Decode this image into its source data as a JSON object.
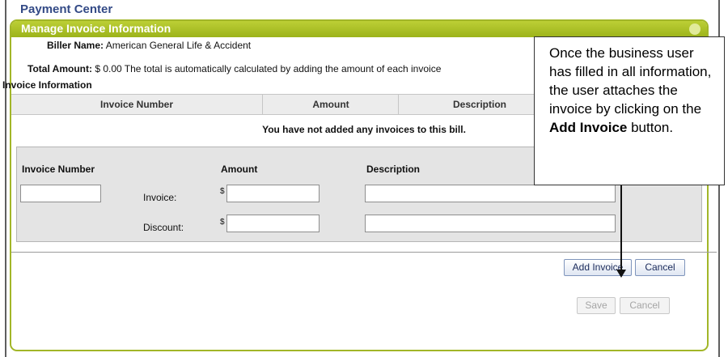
{
  "page": {
    "title": "Payment Center"
  },
  "panel": {
    "title": "Manage Invoice Information"
  },
  "biller": {
    "label": "Biller Name:",
    "value": " American General Life & Accident"
  },
  "total": {
    "label": "Total Amount:",
    "value": " $ 0.00 The total is automatically calculated by adding the amount of each invoice"
  },
  "invoice_section_label": "Invoice Information",
  "table": {
    "columns": [
      "Invoice Number",
      "Amount",
      "Description"
    ],
    "empty_message": "You have not added any invoices to this bill."
  },
  "entry": {
    "invoice_number_label": "Invoice Number",
    "amount_label": "Amount",
    "description_label": "Description",
    "invoice_row_label": "Invoice:",
    "discount_row_label": "Discount:",
    "currency_symbol": "$",
    "invoice_number_value": "",
    "invoice_amount_value": "",
    "invoice_description_value": "",
    "discount_amount_value": "",
    "discount_description_value": ""
  },
  "buttons": {
    "add_invoice": "Add Invoice",
    "cancel": "Cancel",
    "save": "Save",
    "cancel_bottom": "Cancel"
  },
  "callout": {
    "text_1": "Once the business user has filled in all information, the user attaches the invoice by clicking on the ",
    "bold": "Add Invoice",
    "text_2": " button."
  },
  "colors": {
    "title": "#334a86",
    "panel_header": "#a8be24",
    "button_text": "#1b2b5b"
  }
}
